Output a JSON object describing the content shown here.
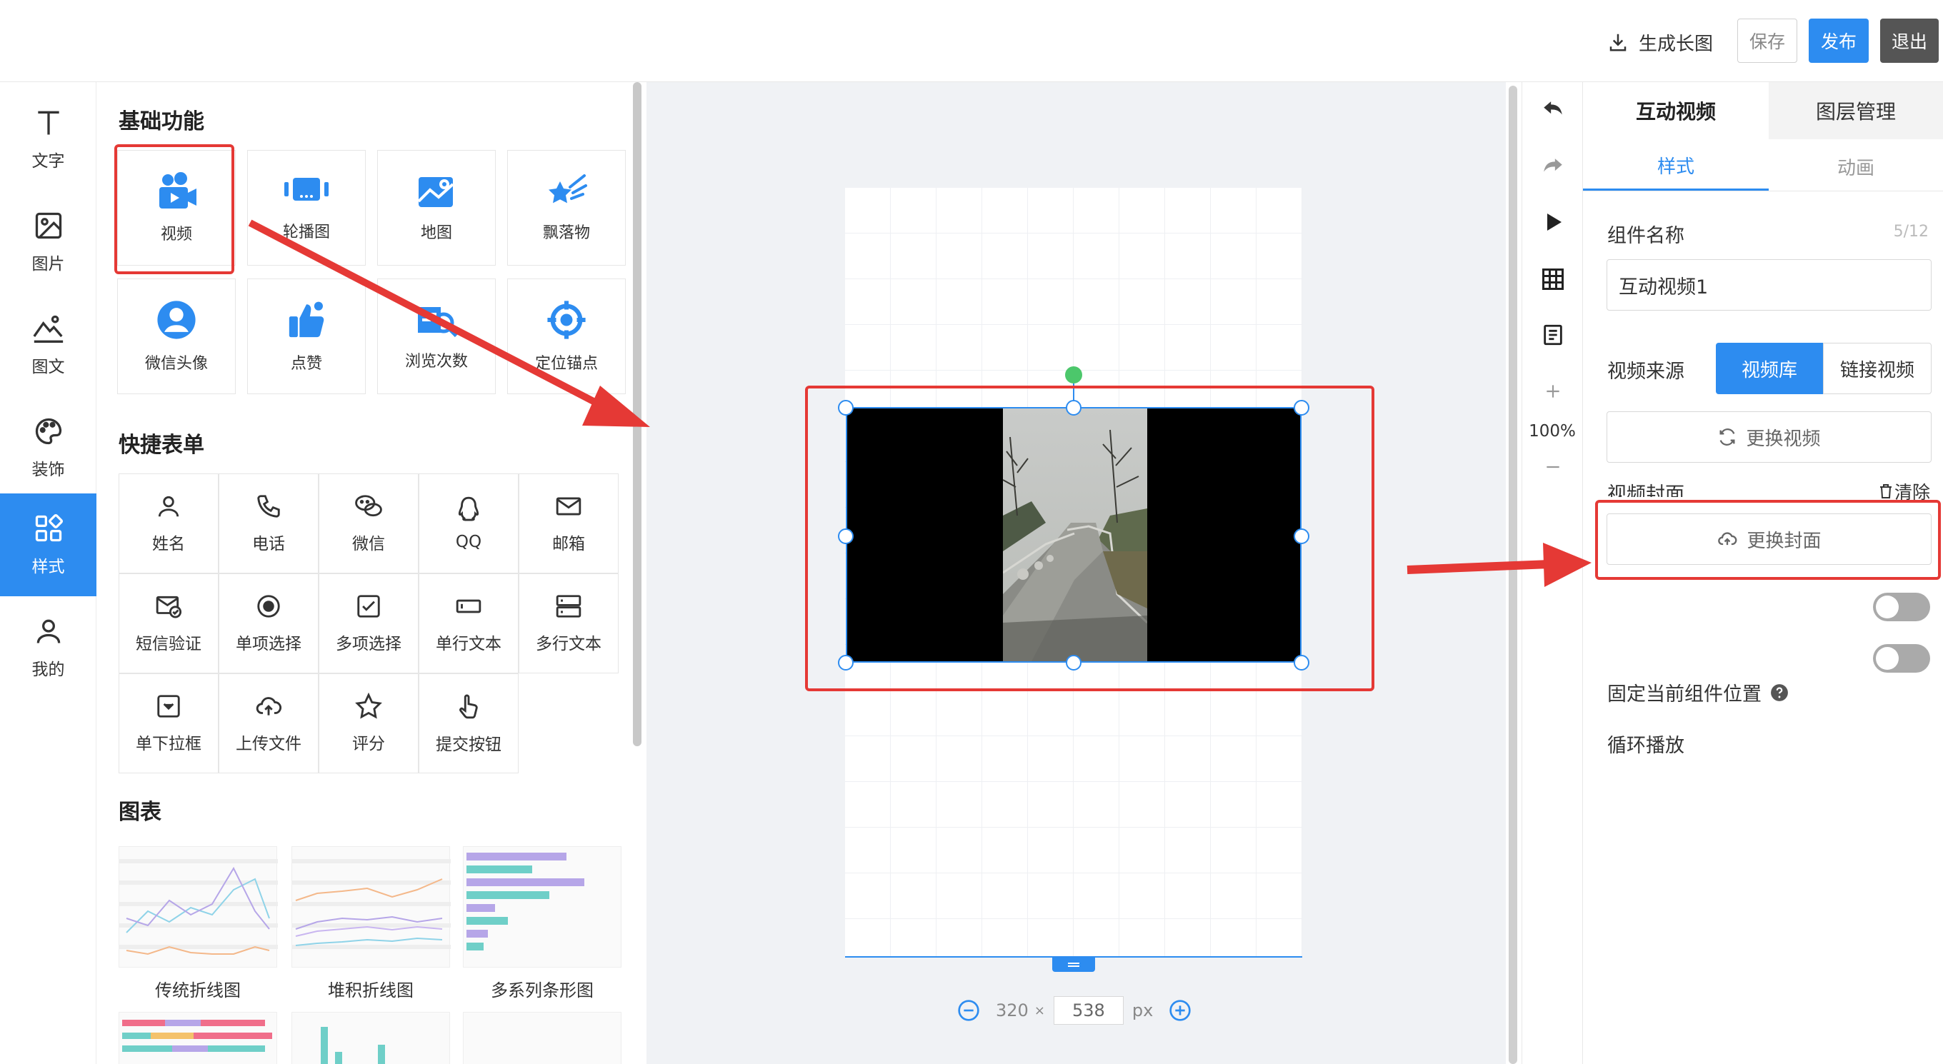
{
  "topbar": {
    "generate_label": "生成长图",
    "save_label": "保存",
    "publish_label": "发布",
    "exit_label": "退出",
    "accent_color": "#2d8cf0"
  },
  "leftnav": {
    "items": [
      {
        "label": "文字",
        "icon": "text-icon"
      },
      {
        "label": "图片",
        "icon": "image-icon"
      },
      {
        "label": "图文",
        "icon": "image-text-icon"
      },
      {
        "label": "装饰",
        "icon": "palette-icon"
      },
      {
        "label": "样式",
        "icon": "grid-style-icon"
      },
      {
        "label": "我的",
        "icon": "user-icon"
      }
    ],
    "active": "样式"
  },
  "panel": {
    "basic_title": "基础功能",
    "basic_items": [
      {
        "label": "视频"
      },
      {
        "label": "轮播图"
      },
      {
        "label": "地图"
      },
      {
        "label": "飘落物"
      },
      {
        "label": "微信头像"
      },
      {
        "label": "点赞"
      },
      {
        "label": "浏览次数"
      },
      {
        "label": "定位锚点"
      }
    ],
    "form_title": "快捷表单",
    "form_items": [
      {
        "label": "姓名"
      },
      {
        "label": "电话"
      },
      {
        "label": "微信"
      },
      {
        "label": "QQ"
      },
      {
        "label": "邮箱"
      },
      {
        "label": "短信验证"
      },
      {
        "label": "单项选择"
      },
      {
        "label": "多项选择"
      },
      {
        "label": "单行文本"
      },
      {
        "label": "多行文本"
      },
      {
        "label": "单下拉框"
      },
      {
        "label": "上传文件"
      },
      {
        "label": "评分"
      },
      {
        "label": "提交按钮"
      }
    ],
    "chart_title": "图表",
    "chart_items": [
      {
        "label": "传统折线图"
      },
      {
        "label": "堆积折线图"
      },
      {
        "label": "多系列条形图"
      }
    ]
  },
  "canvas": {
    "width_value": "320",
    "times": "×",
    "height_value": "538",
    "unit": "px"
  },
  "tools": {
    "zoom": "100%"
  },
  "right": {
    "tab_active": "互动视频",
    "tab_other": "图层管理",
    "subtab_active": "样式",
    "subtab_other": "动画",
    "name_label": "组件名称",
    "name_count": "5/12",
    "name_value": "互动视频1",
    "source_label": "视频来源",
    "source_lib": "视频库",
    "source_link": "链接视频",
    "change_video": "更换视频",
    "cover_label": "视频封面",
    "clear_label": "清除",
    "change_cover": "更换封面",
    "fixed_label": "固定当前组件位置",
    "loop_label": "循环播放",
    "fixed_on": false,
    "loop_on": false
  }
}
